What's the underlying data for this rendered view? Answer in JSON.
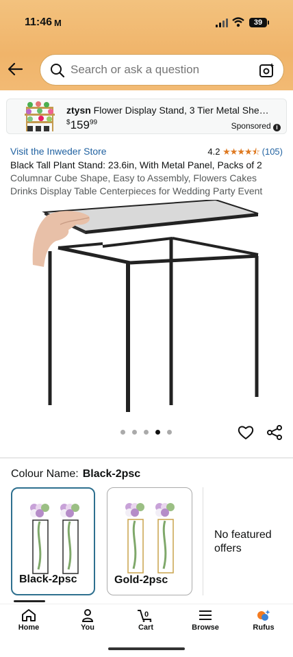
{
  "status_bar": {
    "time": "11:46",
    "mail_icon": "M",
    "battery": "39"
  },
  "search": {
    "placeholder": "Search or ask a question"
  },
  "sponsored": {
    "brand": "ztysn",
    "title": " Flower Display Stand, 3 Tier Metal She…",
    "price_symbol": "$",
    "price_whole": "159",
    "price_fraction": "99",
    "badge": "Sponsored"
  },
  "product": {
    "store_link": "Visit the Inweder Store",
    "rating": "4.2",
    "stars": "★★★★⯪",
    "review_count": "(105)",
    "title_line1": "Black Tall Plant Stand: 23.6in, With Metal Panel, Packs of 2",
    "title_rest": "Columnar Cube Shape, Easy to Assembly, Flowers Cakes Drinks Display Table Centerpieces for Wedding Party Event"
  },
  "gallery": {
    "dot_count": 5,
    "active_dot": 3
  },
  "colour": {
    "label": "Colour Name:",
    "selected": "Black-2psc",
    "options": [
      {
        "label": "Black-2psc",
        "color": "#2b2b2b"
      },
      {
        "label": "Gold-2psc",
        "color": "#c9a24a"
      }
    ],
    "no_offers": "No featured offers"
  },
  "nav": {
    "items": [
      {
        "label": "Home",
        "icon": "home-icon"
      },
      {
        "label": "You",
        "icon": "person-icon"
      },
      {
        "label": "Cart",
        "icon": "cart-icon",
        "count": "0"
      },
      {
        "label": "Browse",
        "icon": "menu-icon"
      },
      {
        "label": "Rufus",
        "icon": "rufus-icon"
      }
    ]
  },
  "colors": {
    "header": "#f0b46a",
    "link": "#2162a1",
    "stars": "#de7921",
    "selected_border": "#2d6f8e"
  }
}
